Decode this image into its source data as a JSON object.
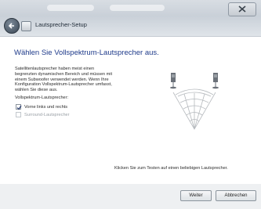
{
  "breadcrumb": "Lautsprecher-Setup",
  "heading": "Wählen Sie Vollspektrum-Lautsprecher aus.",
  "description": "Satellitenlautsprecher haben meist einen begrenzten dynamischen Bereich und müssen mit einem Subwoofer verwendet werden. Wenn Ihre Konfiguration Vollspektrum-Lautsprecher umfasst, wählen Sie diese aus.",
  "group_label": "Vollspektrum-Lautsprecher:",
  "options": [
    {
      "label": "Vorne links und rechts",
      "checked": true,
      "enabled": true
    },
    {
      "label": "Surround-Lautsprecher",
      "checked": false,
      "enabled": false
    }
  ],
  "footer_hint": "Klicken Sie zum Testen auf einen beliebigen Lautsprecher.",
  "buttons": {
    "next": "Weiter",
    "cancel": "Abbrechen"
  },
  "colors": {
    "heading": "#1e3a8a",
    "panel": "#ffffff",
    "chrome": "#e7eaee"
  }
}
